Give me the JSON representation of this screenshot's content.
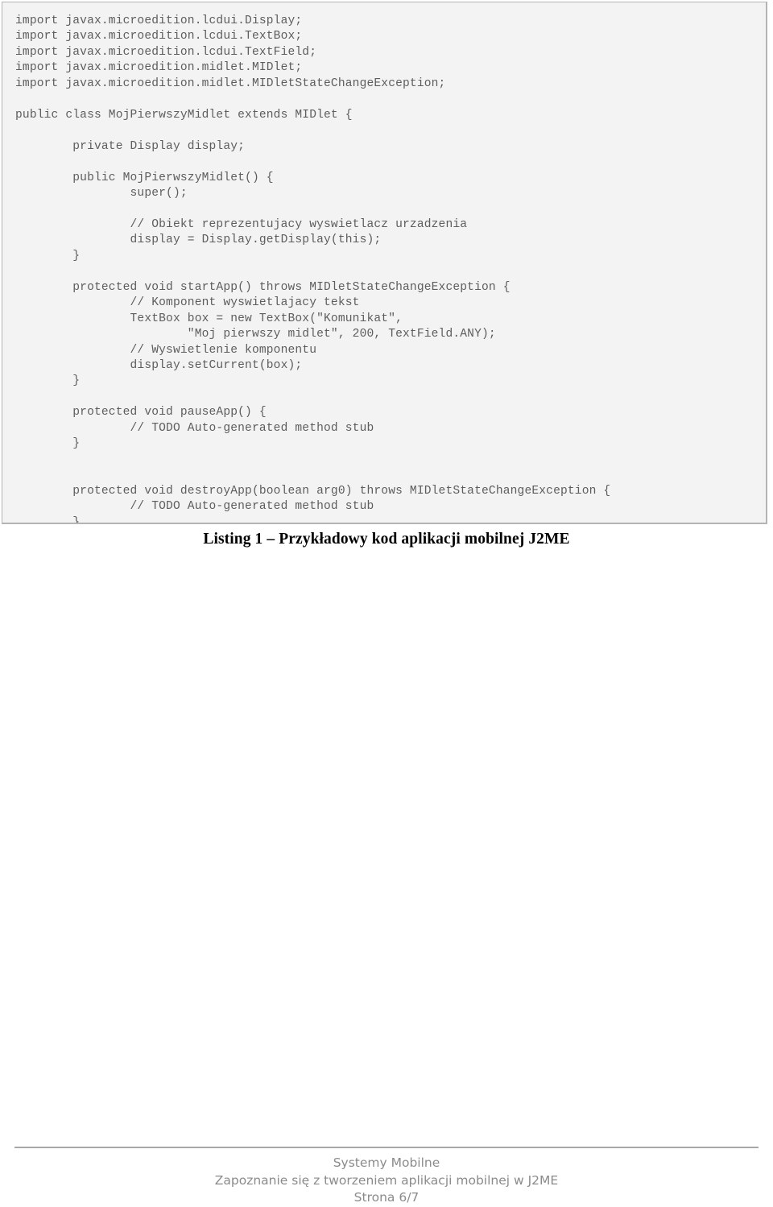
{
  "document": {
    "page_background": "#ffffff"
  },
  "code_listing": {
    "name": "j2me-midlet-source",
    "language": "Java",
    "background": "#f3f3f3",
    "border_color": "#b4b4b4",
    "text_color": "#5d5d5d",
    "lines": [
      "import javax.microedition.lcdui.Display;",
      "import javax.microedition.lcdui.TextBox;",
      "import javax.microedition.lcdui.TextField;",
      "import javax.microedition.midlet.MIDlet;",
      "import javax.microedition.midlet.MIDletStateChangeException;",
      "",
      "public class MojPierwszyMidlet extends MIDlet {",
      "",
      "        private Display display;",
      "",
      "        public MojPierwszyMidlet() {",
      "                super();",
      "",
      "                // Obiekt reprezentujacy wyswietlacz urzadzenia",
      "                display = Display.getDisplay(this);",
      "        }",
      "",
      "        protected void startApp() throws MIDletStateChangeException {",
      "                // Komponent wyswietlajacy tekst",
      "                TextBox box = new TextBox(\"Komunikat\",",
      "                        \"Moj pierwszy midlet\", 200, TextField.ANY);",
      "                // Wyswietlenie komponentu",
      "                display.setCurrent(box);",
      "        }",
      "",
      "        protected void pauseApp() {",
      "                // TODO Auto-generated method stub",
      "        }",
      "",
      "",
      "        protected void destroyApp(boolean arg0) throws MIDletStateChangeException {",
      "                // TODO Auto-generated method stub",
      "        }",
      "}"
    ]
  },
  "caption": {
    "text": "Listing 1 – Przykładowy kod aplikacji mobilnej J2ME"
  },
  "footer": {
    "line1": "Systemy Mobilne",
    "line2": "Zapoznanie się z tworzeniem aplikacji mobilnej w J2ME",
    "line3": "Strona 6/7",
    "rule_color": "#a8a8a8",
    "text_color": "#8b8b8b"
  }
}
